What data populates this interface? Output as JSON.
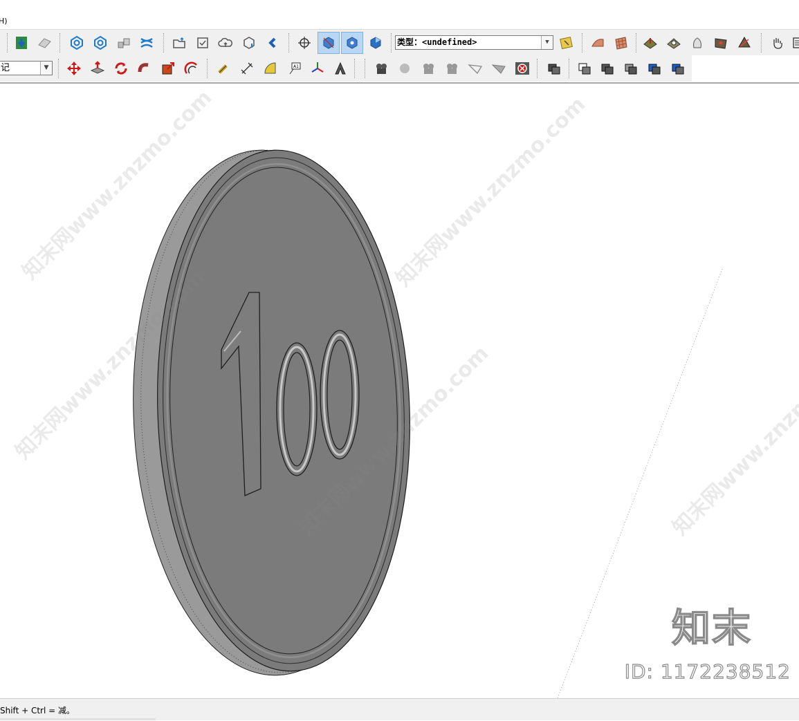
{
  "menubar": {
    "fragment": "H)"
  },
  "toolbar": {
    "type_combo_value": "类型：<undefined>",
    "tag_combo_value": "记"
  },
  "viewport": {
    "coin_label": "100",
    "watermark_text": "知末网www.znzmo.com",
    "brand_logo": "知末",
    "brand_id": "ID: 1172238512"
  },
  "status": {
    "text": "Shift + Ctrl = 减。"
  },
  "colors": {
    "coin_face": "#7b7b7b",
    "coin_edge": "#969696",
    "toolbar_bg": "#f0f0f0",
    "active_button": "#b9d6f2"
  },
  "icons_row1": [
    "component-sync-icon",
    "paint-tray-icon",
    "geo-location-icon",
    "geo-add-icon",
    "shapes-icon",
    "stack-icon",
    "folder-export-icon",
    "checkbox-icon",
    "cloud-upload-icon",
    "cube-export-icon",
    "link-icon",
    "orbit-icon",
    "section-cut-icon",
    "section-display-icon",
    "section-fill-icon",
    "style-icon",
    "sandbox-from-contours-icon",
    "sandbox-grid-icon",
    "stamp-icon",
    "drape-icon",
    "smoove-icon",
    "add-detail-icon",
    "flip-edge-icon",
    "hand-icon",
    "list-icon"
  ],
  "icons_row2": [
    "move-icon",
    "push-pull-icon",
    "rotate-icon",
    "follow-me-icon",
    "scale-icon",
    "offset-icon",
    "tape-measure-icon",
    "dimension-icon",
    "protractor-icon",
    "text-icon",
    "axes-icon",
    "3d-text-icon",
    "camera-position-icon",
    "walk-icon",
    "look-around-icon",
    "zoom-window-icon",
    "section-plane-icon",
    "front-face-icon",
    "shadow-toggle-icon",
    "outer-shell-icon",
    "intersect-icon",
    "union-icon",
    "subtract-icon",
    "trim-icon",
    "split-icon"
  ]
}
